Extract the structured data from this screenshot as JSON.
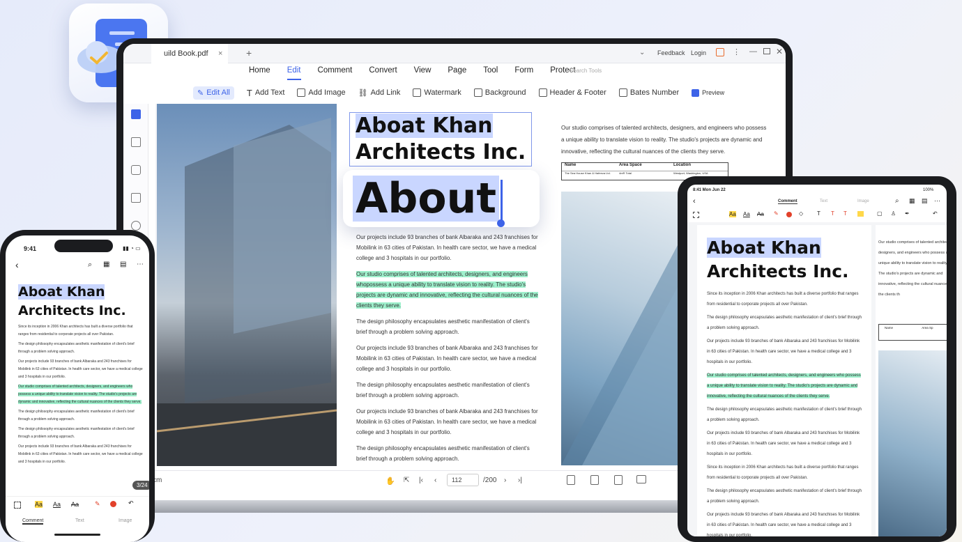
{
  "laptop": {
    "tab_title": "uild Book.pdf",
    "tab_close": "×",
    "tab_add": "+",
    "feedback": "Feedback",
    "login": "Login",
    "menu": [
      "Home",
      "Edit",
      "Comment",
      "Convert",
      "View",
      "Page",
      "Tool",
      "Form",
      "Protect"
    ],
    "search_tools": "Search Tools",
    "toolbar": {
      "edit_all": "Edit All",
      "add_text": "Add Text",
      "add_image": "Add Image",
      "add_link": "Add Link",
      "watermark": "Watermark",
      "background": "Background",
      "header_footer": "Header & Footer",
      "bates": "Bates Number",
      "preview": "Preview"
    },
    "doc_title_1": "Aboat Khan",
    "doc_title_2": "Architects Inc.",
    "popup_word": "About",
    "para_intro": "Our projects include 93 branches of bank Albaraka and 243 franchises for Mobilink in 63 cities of Pakistan. In health care sector, we have a medical college and 3 hospitals in our portfolio.",
    "para_highlight": "Our studio comprises of talented architects, designers, and engineers whopossess a unique ability to translate vision to reality. The studio's projects are dynamic and innovative, reflecting the cultural nuances of the clients they serve.",
    "para_design": "The design philosophy encapsulates aesthetic manifestation of client's brief through a problem solving approach.",
    "para_projects": "Our projects include 93 branches of bank Albaraka and 243 franchises for Mobilink in 63 cities of Pakistan. In health care sector, we have a medical college and 3 hospitals in our portfolio.",
    "right_text": "Our studio comprises of talented architects, designers, and engineers who possess a unique ability to translate vision to reality. The studio's projects are dynamic and innovative, reflecting the cultural nuances of the clients they serve.",
    "table": {
      "headers": [
        "Name",
        "Area Space",
        "Location"
      ],
      "row": [
        "The Sea House Khan & Hafeeza Ltd.",
        "4mR Total",
        "Westport, Washington, USA"
      ]
    },
    "bottom": {
      "zoom_unit": "cm",
      "page_current": "112",
      "page_total": "/200"
    }
  },
  "phone": {
    "time": "9:41",
    "title_1": "Aboat Khan",
    "title_2": "Architects Inc.",
    "p1": "Since its inception in 2006 Khan architects has built a diverse portfolio that ranges from residential to corporate projects all over Pakistan.",
    "p2": "The design philosophy encapsulates aesthetic manifestation of client's brief through a problem solving approach.",
    "p3": "Our projects include 93 branches of bank Albaraka and 243 franchises for Mobilink in 63 cities of Pakistan. In health care sector, we have a medical college and 3 hospitals in our portfolio.",
    "p4": "Our studio comprises of talented architects, designers, and engineers who possess a unique ability to translate vision to reality. The studio's projects are dynamic and innovative, reflecting the cultural nuances of the clients they serve.",
    "p5": "The design philosophy encapsulates aesthetic manifestation of client's brief through a problem solving approach.",
    "p6": "The design philosophy encapsulates aesthetic manifestation of client's brief through a problem solving approach.",
    "p7": "Our projects include 93 branches of bank Albaraka and 243 franchises for Mobilink in 63 cities of Pakistan. In health care sector, we have a medical college and 3 hospitals in our portfolio.",
    "page_badge": "3/24",
    "tools": [
      "Aa",
      "Aa",
      "Aa"
    ],
    "tabs": [
      "Comment",
      "Text",
      "Image"
    ]
  },
  "tablet": {
    "time": "8:41  Mon Jun 22",
    "battery": "100%",
    "tabs": [
      "Comment",
      "Text",
      "Image"
    ],
    "tools": [
      "Aa",
      "Aa",
      "Aa"
    ],
    "title_1": "Aboat Khan",
    "title_2": "Architects Inc.",
    "p1": "Since its inception in 2006 Khan architects has built a diverse portfolio that ranges from residential to corporate projects all over Pakistan.",
    "p2": "The design philosophy encapsulates aesthetic manifestation of client's brief through a problem solving approach.",
    "p3": "Our projects include 93 branches of bank Albaraka and 243 franchises for Mobilink in 63 cities of Pakistan. In health care sector, we have a medical college and 3 hospitals in our portfolio.",
    "p4": "Our studio comprises of talented architects, designers, and engineers who possess a unique ability to translate vision to reality. The studio's projects are dynamic and innovative, reflecting the cultural nuances of the clients they serve.",
    "p5": "The design philosophy encapsulates aesthetic manifestation of client's brief through a problem solving approach.",
    "p6": "Our projects include 93 branches of bank Albaraka and 243 franchises for Mobilink in 63 cities of Pakistan. In health care sector, we have a medical college and 3 hospitals in our portfolio.",
    "p7": "Since its inception in 2006 Khan architects has built a diverse portfolio that ranges from residential to corporate projects all over Pakistan.",
    "p8": "The design philosophy encapsulates aesthetic manifestation of client's brief through a problem solving approach.",
    "p9": "Our projects include 93 branches of bank Albaraka and 243 franchises for Mobilink in 63 cities of Pakistan. In health care sector, we have a medical college and 3 hospitals in our portfolio.",
    "side_1": "Our studio comprises of talented architects, designers, and engineers who possess a unique ability to translate vision to reality. The studio's projects are dynamic and innovative, reflecting the cultural nuances of the clients th",
    "side_table_name": "Name",
    "side_table_area": "Area Sp"
  },
  "colors": {
    "accent": "#3d63e8",
    "highlight": "#9ef0cc",
    "selection": "#c9d6ff"
  }
}
